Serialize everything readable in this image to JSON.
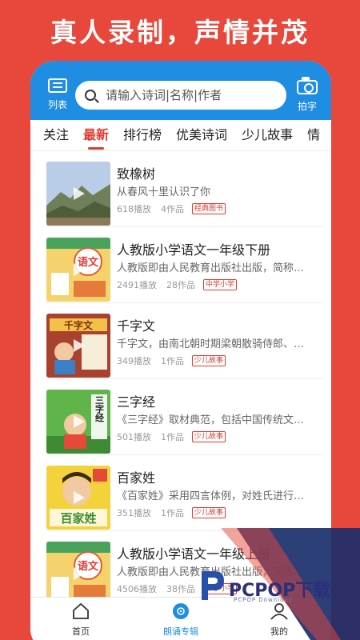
{
  "headline": "真人录制，声情并茂",
  "topbar": {
    "menu_label": "列表",
    "search_placeholder": "请输入诗词|名称|作者",
    "photo_label": "拍字"
  },
  "tabs": [
    {
      "label": "关注",
      "active": false
    },
    {
      "label": "最新",
      "active": true
    },
    {
      "label": "排行榜",
      "active": false
    },
    {
      "label": "优美诗词",
      "active": false
    },
    {
      "label": "少儿故事",
      "active": false
    },
    {
      "label": "情",
      "active": false
    }
  ],
  "items": [
    {
      "title": "致橡树",
      "desc": "从春风十里认识了你",
      "plays": "618播放",
      "works": "4作品",
      "tag": "经典图书",
      "cover_text": ""
    },
    {
      "title": "人教版小学语文一年级下册",
      "desc": "人教版即由人民教育出版社出版，简称…",
      "plays": "2491播放",
      "works": "28作品",
      "tag": "中学小学",
      "cover_text": "语文"
    },
    {
      "title": "千字文",
      "desc": "千字文，由南北朝时期梁朝散骑侍郎、…",
      "plays": "349播放",
      "works": "1作品",
      "tag": "少儿故事",
      "cover_text": "千字文"
    },
    {
      "title": "三字经",
      "desc": "《三字经》取材典范，包括中国传统文…",
      "plays": "501播放",
      "works": "1作品",
      "tag": "少儿故事",
      "cover_text": "三字经"
    },
    {
      "title": "百家姓",
      "desc": "《百家姓》采用四言体例，对姓氏进行…",
      "plays": "351播放",
      "works": "1作品",
      "tag": "少儿故事",
      "cover_text": "百家姓"
    },
    {
      "title": "人教版小学语文一年级上册",
      "desc": "人教版即由人民教育出版社出版，简称…",
      "plays": "4506播放",
      "works": "38作品",
      "tag": "中学小学",
      "cover_text": "语文"
    }
  ],
  "bottom_nav": [
    {
      "label": "首页",
      "icon": "home-icon",
      "active": false
    },
    {
      "label": "朗诵专辑",
      "icon": "album-icon",
      "active": true
    },
    {
      "label": "我的",
      "icon": "user-icon",
      "active": false
    }
  ],
  "watermark": {
    "text": "PCPOP下载",
    "subtext": "PCPOP Download"
  },
  "colors": {
    "brand_red": "#e8473b",
    "accent_blue": "#1e8de2",
    "tag_red": "#e03a2f"
  }
}
